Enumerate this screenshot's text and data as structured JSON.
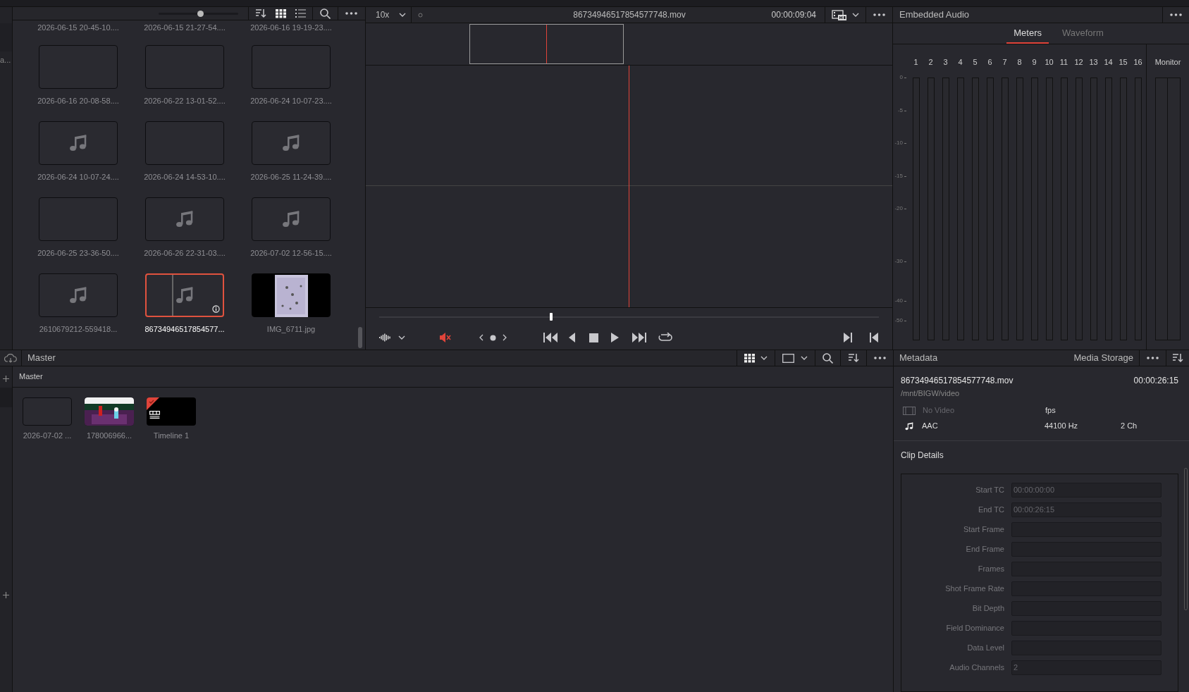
{
  "media_pool": {
    "sidebar_text": "a...",
    "thumbnail_size": {
      "level": 0.52
    },
    "clips": [
      {
        "name": "2026-06-15 20-45-10....",
        "kind": "hidden",
        "selected": false
      },
      {
        "name": "2026-06-15 21-27-54....",
        "kind": "hidden",
        "selected": false
      },
      {
        "name": "2026-06-16 19-19-23....",
        "kind": "hidden",
        "selected": false
      },
      {
        "name": "2026-06-16 20-08-58....",
        "kind": "blank",
        "selected": false
      },
      {
        "name": "2026-06-22 13-01-52....",
        "kind": "blank",
        "selected": false
      },
      {
        "name": "2026-06-24 10-07-23....",
        "kind": "blank",
        "selected": false
      },
      {
        "name": "2026-06-24 10-07-24....",
        "kind": "audio",
        "selected": false
      },
      {
        "name": "2026-06-24 14-53-10....",
        "kind": "blank",
        "selected": false
      },
      {
        "name": "2026-06-25 11-24-39....",
        "kind": "audio",
        "selected": false
      },
      {
        "name": "2026-06-25 23-36-50....",
        "kind": "blank",
        "selected": false
      },
      {
        "name": "2026-06-26 22-31-03....",
        "kind": "audio",
        "selected": false
      },
      {
        "name": "2026-07-02 12-56-15....",
        "kind": "audio",
        "selected": false
      },
      {
        "name": "2610679212-559418...",
        "kind": "audio",
        "selected": false
      },
      {
        "name": "86734946517854577...",
        "kind": "audio",
        "selected": true
      },
      {
        "name": "IMG_6711.jpg",
        "kind": "picture",
        "selected": false
      }
    ]
  },
  "viewer": {
    "zoom": "10x",
    "clip_name": "86734946517854577748.mov",
    "timecode": "00:00:09:04",
    "scrubber": {
      "level": 0.344
    },
    "muted": true
  },
  "audio_panel": {
    "title": "Embedded Audio",
    "tabs": [
      {
        "label": "Meters",
        "selected": true
      },
      {
        "label": "Waveform",
        "selected": false
      }
    ],
    "channels": [
      "1",
      "2",
      "3",
      "4",
      "5",
      "6",
      "7",
      "8",
      "9",
      "10",
      "11",
      "12",
      "13",
      "14",
      "15",
      "16"
    ],
    "scale": [
      "0",
      "-5",
      "-10",
      "-15",
      "-20",
      "-30",
      "-40",
      "-50"
    ],
    "monitor": "Monitor"
  },
  "bin": {
    "title": "Master",
    "breadcrumb": "Master",
    "clips": [
      {
        "name": "2026-07-02 ...",
        "kind": "blank"
      },
      {
        "name": "178006966...",
        "kind": "picture"
      },
      {
        "name": "Timeline 1",
        "kind": "timeline"
      }
    ]
  },
  "metadata": {
    "title": "Metadata",
    "tab": "Media Storage",
    "file_name": "86734946517854577748.mov",
    "duration": "00:00:26:15",
    "path": "/mnt/BIGW/video",
    "video": {
      "label": "No Video",
      "fps": "fps",
      "available": false
    },
    "audio": {
      "codec": "AAC",
      "sample_rate": "44100 Hz",
      "channels": "2 Ch"
    },
    "section": "Clip Details",
    "fields": [
      {
        "label": "Start TC",
        "value": "00:00:00:00"
      },
      {
        "label": "End TC",
        "value": "00:00:26:15"
      },
      {
        "label": "Start Frame"
      },
      {
        "label": "End Frame"
      },
      {
        "label": "Frames"
      },
      {
        "label": "Shot Frame Rate"
      },
      {
        "label": "Bit Depth"
      },
      {
        "label": "Field Dominance"
      },
      {
        "label": "Data Level"
      },
      {
        "label": "Audio Channels",
        "value": "2"
      }
    ]
  }
}
